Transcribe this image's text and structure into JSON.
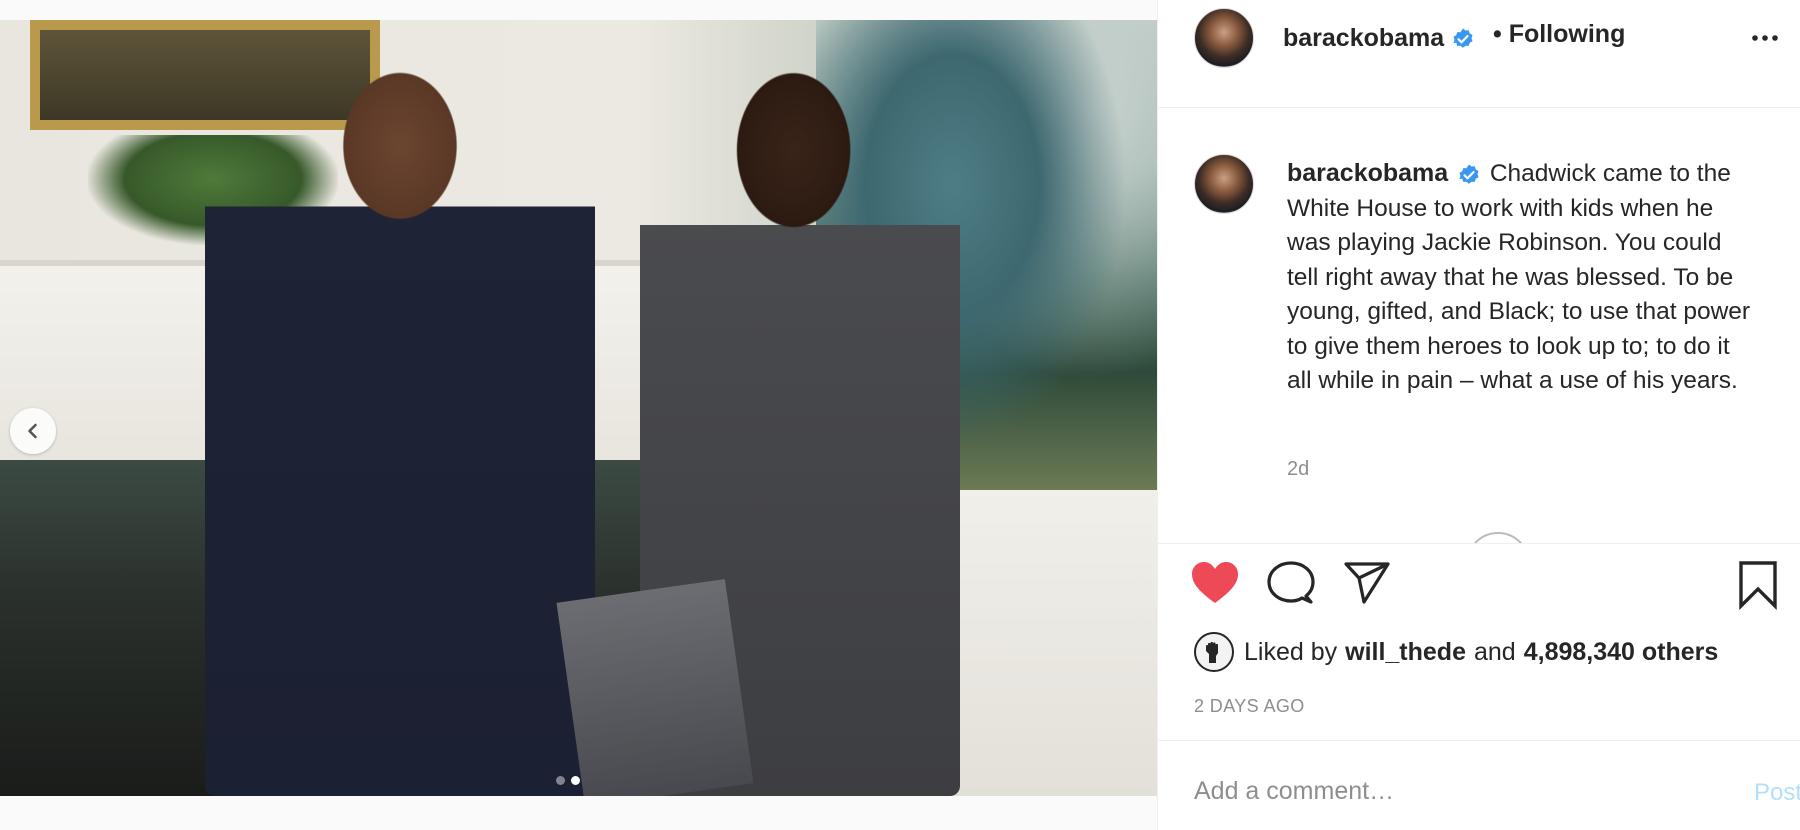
{
  "post": {
    "username": "barackobama",
    "following_label": "• Following",
    "caption": "Chadwick came to the White House to work with kids when he was playing Jackie Robinson. You could tell right away that he was blessed. To be young, gifted, and Black; to use that power to give them heroes to look up to; to do it all while in pain – what a use of his years.",
    "time_ago": "2d",
    "liked_by_prefix": "Liked by",
    "liked_by_user": "will_thede",
    "liked_by_and": "and",
    "likes_others": "4,898,340 others",
    "date": "2 DAYS AGO",
    "comment_placeholder": "Add a comment…",
    "post_label": "Post"
  },
  "carousel": {
    "slides": 2,
    "active_slide": 2
  },
  "icons": {
    "verified": "verified-badge-icon",
    "more": "more-options-icon",
    "prev": "chevron-left-icon",
    "like": "heart-filled-icon",
    "comment": "comment-bubble-icon",
    "share": "paper-plane-icon",
    "save": "bookmark-icon",
    "liker": "raised-fist-icon"
  },
  "colors": {
    "heart": "#ed4956",
    "verified": "#3897f0",
    "post_disabled": "#b2dffc",
    "secondary_text": "#8e8e8e"
  },
  "states": {
    "liked": true
  }
}
